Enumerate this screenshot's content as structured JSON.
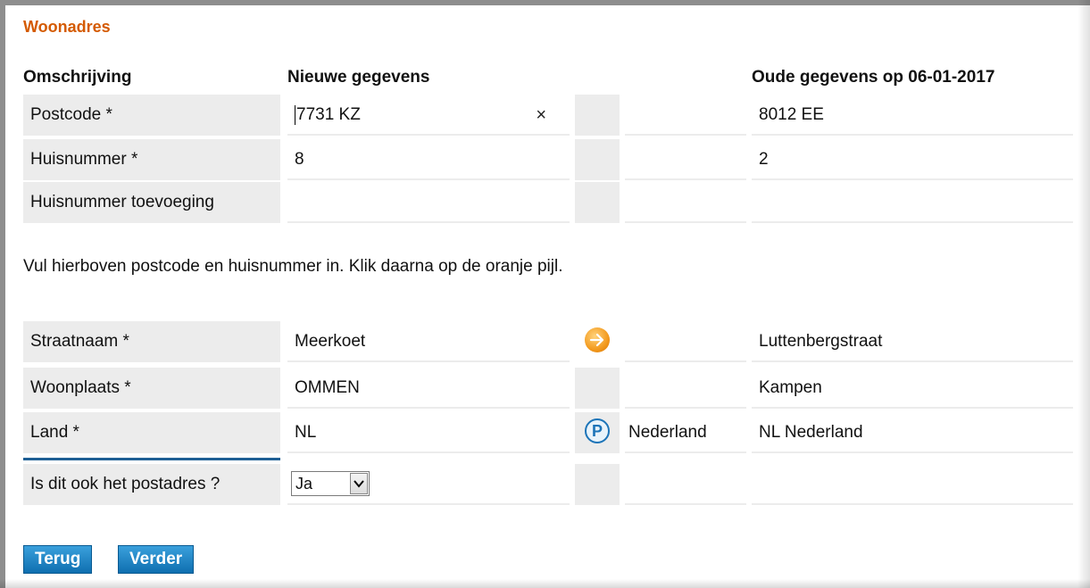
{
  "section_title": "Woonadres",
  "headers": {
    "description": "Omschrijving",
    "new_data": "Nieuwe gegevens",
    "old_data": "Oude gegevens op 06-01-2017"
  },
  "rows_top": [
    {
      "label": "Postcode *",
      "new_value": "7731 KZ",
      "old_value": "8012 EE",
      "clear_symbol": "×"
    },
    {
      "label": "Huisnummer *",
      "new_value": "8",
      "old_value": "2"
    },
    {
      "label": "Huisnummer toevoeging",
      "new_value": "",
      "old_value": ""
    }
  ],
  "instruction": "Vul hierboven postcode en huisnummer in. Klik daarna op de oranje pijl.",
  "rows_bottom": [
    {
      "label": "Straatnaam *",
      "new_value": "Meerkoet",
      "icon": "orange-arrow-icon",
      "old_value": "Luttenbergstraat"
    },
    {
      "label": "Woonplaats *",
      "new_value": "OMMEN",
      "old_value": "Kampen"
    },
    {
      "label": "Land *",
      "new_value": "NL",
      "icon": "lookup-icon",
      "description": "Nederland",
      "old_value": "NL Nederland"
    }
  ],
  "postal_question": {
    "label": "Is dit ook het postadres ?",
    "selected": "Ja"
  },
  "buttons": {
    "back": "Terug",
    "next": "Verder"
  },
  "colors": {
    "title": "#d45a00",
    "label_bg": "#ececec",
    "button_bg": "#1677b8",
    "focus_line": "#1e5f94"
  }
}
